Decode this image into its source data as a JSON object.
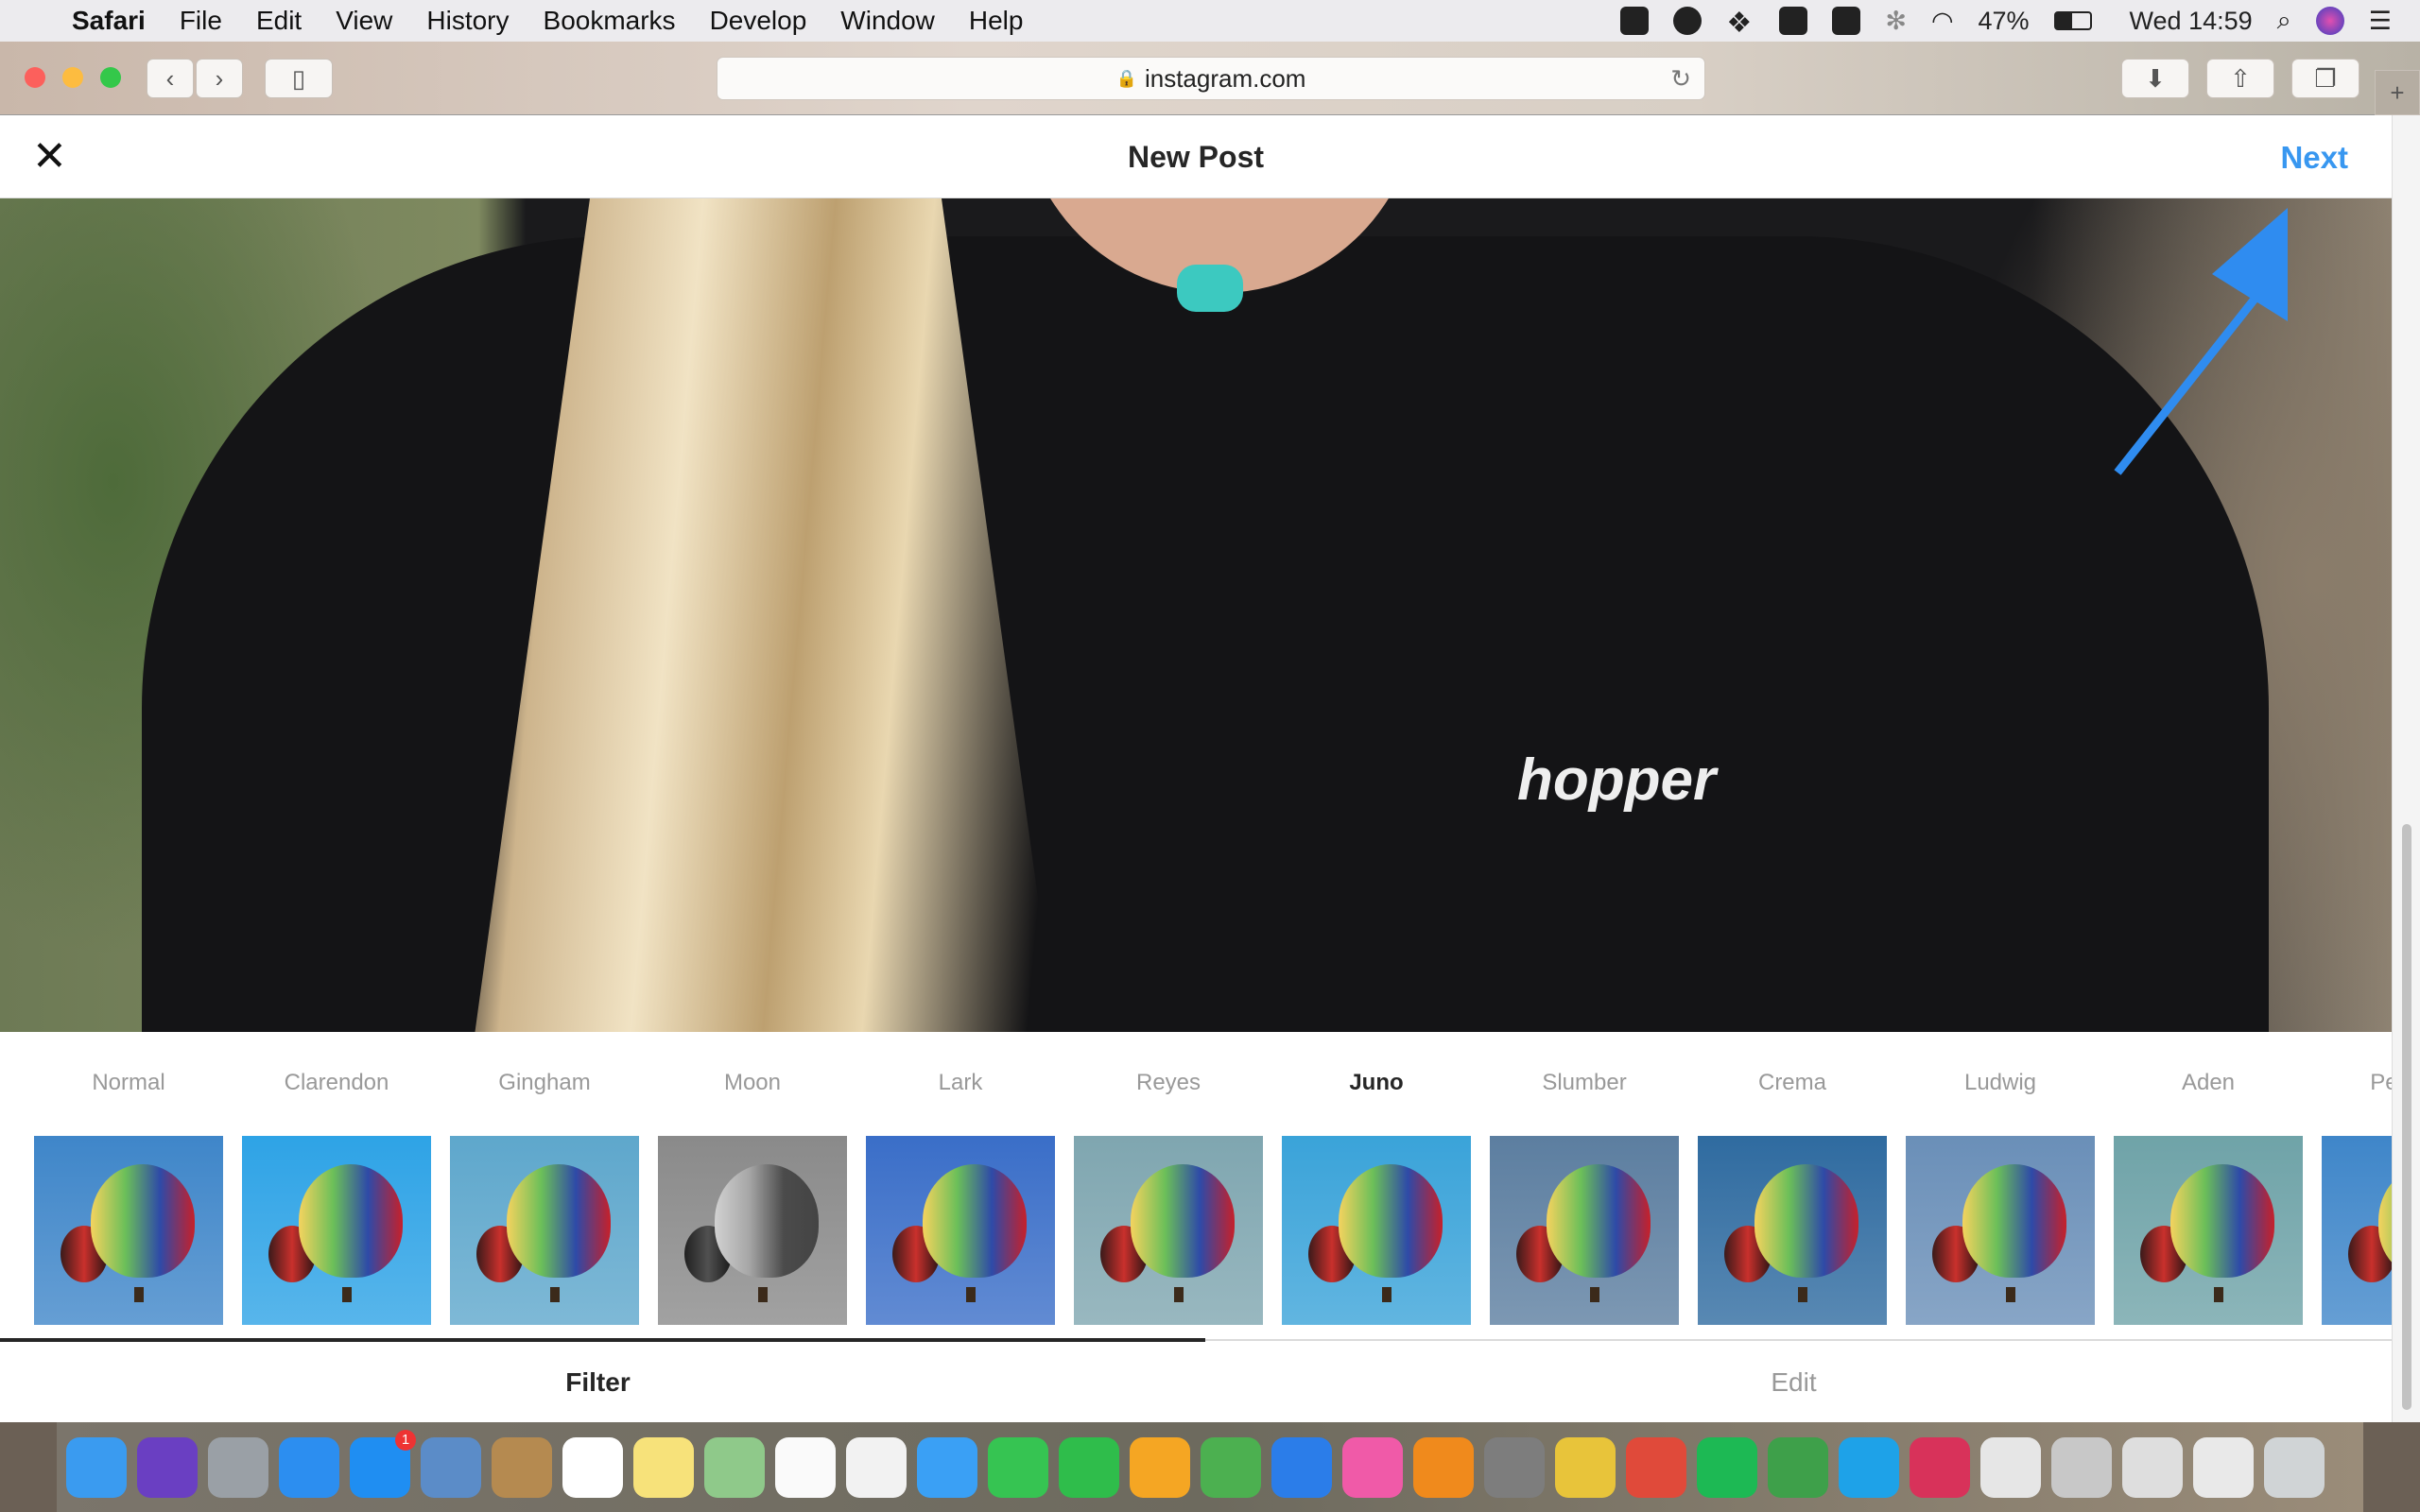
{
  "menubar": {
    "app": "Safari",
    "items": [
      "File",
      "Edit",
      "View",
      "History",
      "Bookmarks",
      "Develop",
      "Window",
      "Help"
    ],
    "battery": "47%",
    "clock": "Wed 14:59"
  },
  "browser": {
    "url": "instagram.com"
  },
  "header": {
    "title": "New Post",
    "next_label": "Next"
  },
  "photo": {
    "shirt_text": "hopper"
  },
  "filters": {
    "selected": "Juno",
    "items": [
      {
        "name": "Normal",
        "tint": "#3f86c9"
      },
      {
        "name": "Clarendon",
        "tint": "#2ea3e6"
      },
      {
        "name": "Gingham",
        "tint": "#5ea7cc"
      },
      {
        "name": "Moon",
        "tint": "#8a8a8a"
      },
      {
        "name": "Lark",
        "tint": "#3a6ec8"
      },
      {
        "name": "Reyes",
        "tint": "#7fa6b0"
      },
      {
        "name": "Juno",
        "tint": "#3aa3d9"
      },
      {
        "name": "Slumber",
        "tint": "#5c7ea0"
      },
      {
        "name": "Crema",
        "tint": "#2f6ba0"
      },
      {
        "name": "Ludwig",
        "tint": "#6a8fb8"
      },
      {
        "name": "Aden",
        "tint": "#6fa3a8"
      },
      {
        "name": "Perpetua",
        "tint": "#3f86c9"
      }
    ]
  },
  "tabs": {
    "filter": "Filter",
    "edit": "Edit",
    "active": "Filter"
  },
  "dock": {
    "apps": [
      {
        "name": "finder",
        "color": "#3a9bf0"
      },
      {
        "name": "siri",
        "color": "#6a3fc2"
      },
      {
        "name": "launchpad",
        "color": "#9aa0a6"
      },
      {
        "name": "safari",
        "color": "#2c8ef0"
      },
      {
        "name": "app-store",
        "color": "#1f8ef2",
        "badge": "1"
      },
      {
        "name": "preview",
        "color": "#5b8cc8"
      },
      {
        "name": "contacts",
        "color": "#b58a50"
      },
      {
        "name": "calendar",
        "color": "#ffffff"
      },
      {
        "name": "notes",
        "color": "#f7e27a"
      },
      {
        "name": "maps",
        "color": "#8fc98a"
      },
      {
        "name": "reminders",
        "color": "#fafafa"
      },
      {
        "name": "photos",
        "color": "#f2f2f2"
      },
      {
        "name": "messages",
        "color": "#3aa0f5"
      },
      {
        "name": "facetime",
        "color": "#36c452"
      },
      {
        "name": "whatsapp",
        "color": "#2fbd4b"
      },
      {
        "name": "pages",
        "color": "#f5a623"
      },
      {
        "name": "numbers",
        "color": "#4cb050"
      },
      {
        "name": "keynote",
        "color": "#2b7de9"
      },
      {
        "name": "itunes",
        "color": "#f05aa8"
      },
      {
        "name": "ibooks",
        "color": "#f08a1c"
      },
      {
        "name": "system-preferences",
        "color": "#7d7d7d"
      },
      {
        "name": "slides",
        "color": "#e8c43a"
      },
      {
        "name": "chrome",
        "color": "#e04a3a"
      },
      {
        "name": "spotify",
        "color": "#1db954"
      },
      {
        "name": "evernote",
        "color": "#3ea04a"
      },
      {
        "name": "skype",
        "color": "#1ea2e8"
      },
      {
        "name": "airmail",
        "color": "#d8325a"
      },
      {
        "name": "window-1",
        "color": "#e6e6e6"
      },
      {
        "name": "window-2",
        "color": "#c8c8c8"
      },
      {
        "name": "window-3",
        "color": "#dedede"
      },
      {
        "name": "window-4",
        "color": "#e9e9e9"
      },
      {
        "name": "trash",
        "color": "#d0d4d6"
      }
    ]
  },
  "colors": {
    "accent": "#3897f0",
    "annotation_arrow": "#2f8cf0"
  }
}
